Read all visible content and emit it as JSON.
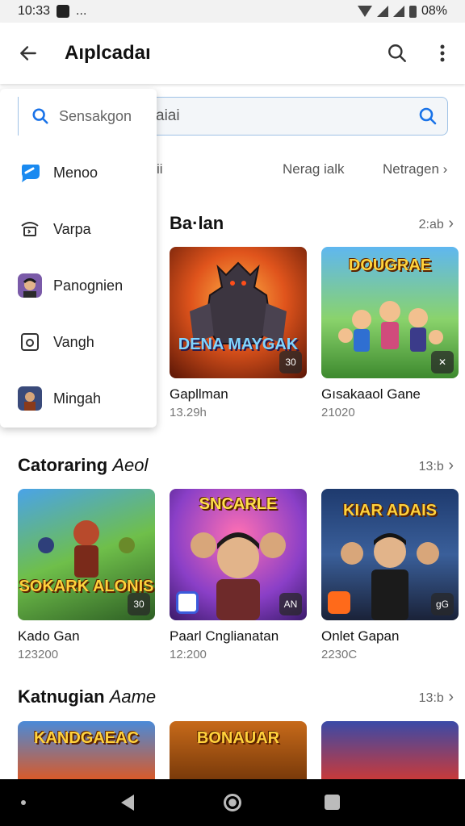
{
  "status_bar": {
    "time": "10:33",
    "dots": "...",
    "battery": "08%"
  },
  "app_bar": {
    "title": "Aıplcadaı",
    "back_icon": "arrow-left-icon",
    "search_icon": "search-icon",
    "menu_icon": "more-vert-icon"
  },
  "search": {
    "value": "aiai"
  },
  "filters": [
    "Nerag ialk",
    "Netragen"
  ],
  "dropdown": {
    "search_label": "Sensakgon",
    "items": [
      {
        "label": "Menoo",
        "icon": "chat-bubble-icon"
      },
      {
        "label": "Varpa",
        "icon": "terminal-icon"
      },
      {
        "label": "Panognien",
        "icon": "avatar-icon"
      },
      {
        "label": "Vangh",
        "icon": "square-icon"
      },
      {
        "label": "Mingah",
        "icon": "game-thumb-icon"
      }
    ]
  },
  "sections": [
    {
      "title": "Ba·lan",
      "more": "2:ab",
      "cards": [
        {
          "name": "Gapllman",
          "meta": "13.29h",
          "art_title": "DENA MAYGAK",
          "badge": "30"
        },
        {
          "name": "Gısakaaol Gane",
          "meta": "21020",
          "art_title": "DOUGRAE",
          "badge": "✕"
        }
      ]
    },
    {
      "title": "Catoraring",
      "title_light": "Aeol",
      "more": "13:b",
      "cards": [
        {
          "name": "Kado Gan",
          "meta": "123200",
          "art_title": "SOKARK ALONIS",
          "badge": "30"
        },
        {
          "name": "Paarl Cnglianatan",
          "meta": "12:200",
          "art_title": "SNCARLE",
          "badge": "AN"
        },
        {
          "name": "Onlet Gapan",
          "meta": "2230C",
          "art_title": "KIAR ADAIS",
          "badge": "gG"
        }
      ]
    },
    {
      "title": "Katnugian",
      "title_light": "Aame",
      "more": "13:b",
      "cards": [
        {
          "art_title": "KANDGAEAC"
        },
        {
          "art_title": "BONAUAR"
        },
        {
          "art_title": ""
        }
      ]
    }
  ],
  "colors": {
    "accent": "#1a73e8",
    "search_border": "#9fc2e6",
    "nav_bar": "#000000"
  }
}
